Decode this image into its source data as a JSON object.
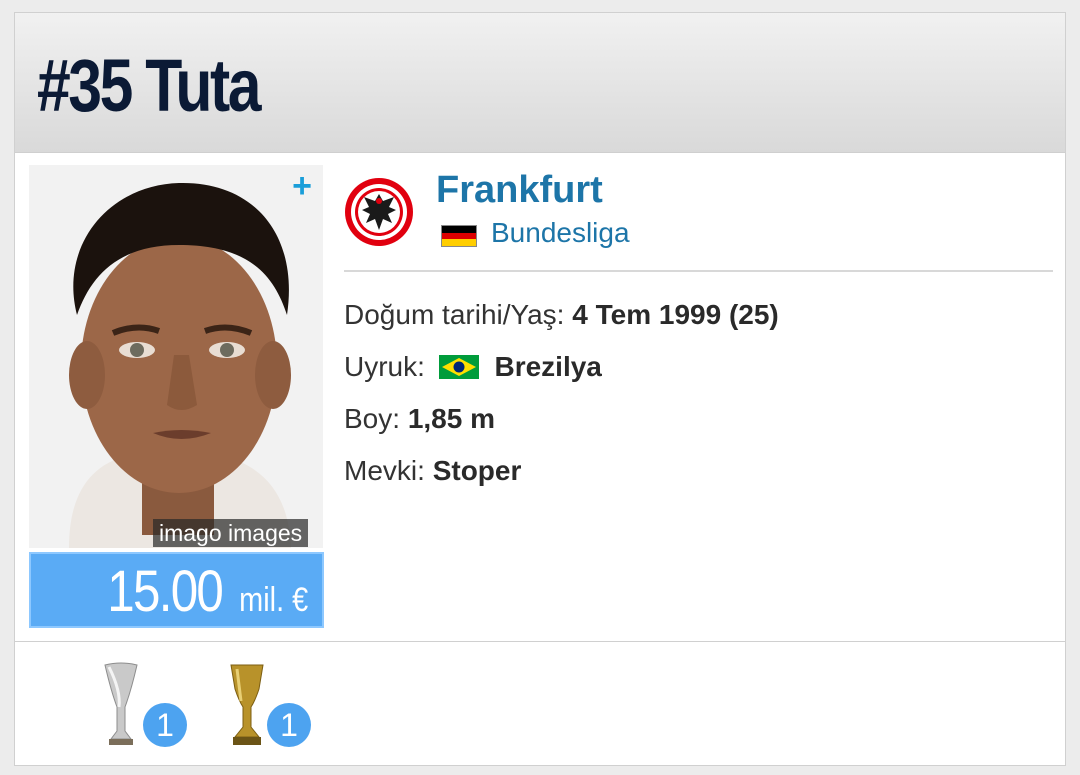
{
  "header": {
    "title": "#35 Tuta"
  },
  "photo": {
    "credit": "imago images",
    "plus_icon": "plus-icon"
  },
  "market_value": {
    "amount": "15.00",
    "unit": "mil. €"
  },
  "club": {
    "name": "Frankfurt",
    "league": "Bundesliga",
    "logo_icon": "eagle-crest-icon",
    "league_flag": "germany-flag-icon"
  },
  "details": {
    "birth_label": "Doğum tarihi/Yaş:",
    "birth_value": "4 Tem 1999 (25)",
    "nationality_label": "Uyruk:",
    "nationality_value": "Brezilya",
    "nationality_flag": "brazil-flag-icon",
    "height_label": "Boy:",
    "height_value": "1,85 m",
    "position_label": "Mevki:",
    "position_value": "Stoper"
  },
  "trophies": [
    {
      "icon": "europa-league-trophy-icon",
      "count": "1"
    },
    {
      "icon": "super-cup-trophy-icon",
      "count": "1"
    }
  ],
  "colors": {
    "title": "#0b1a35",
    "link": "#1d75a8",
    "value_bg": "#5aabf5",
    "badge": "#4da3f0",
    "plus": "#1a9ed9"
  }
}
